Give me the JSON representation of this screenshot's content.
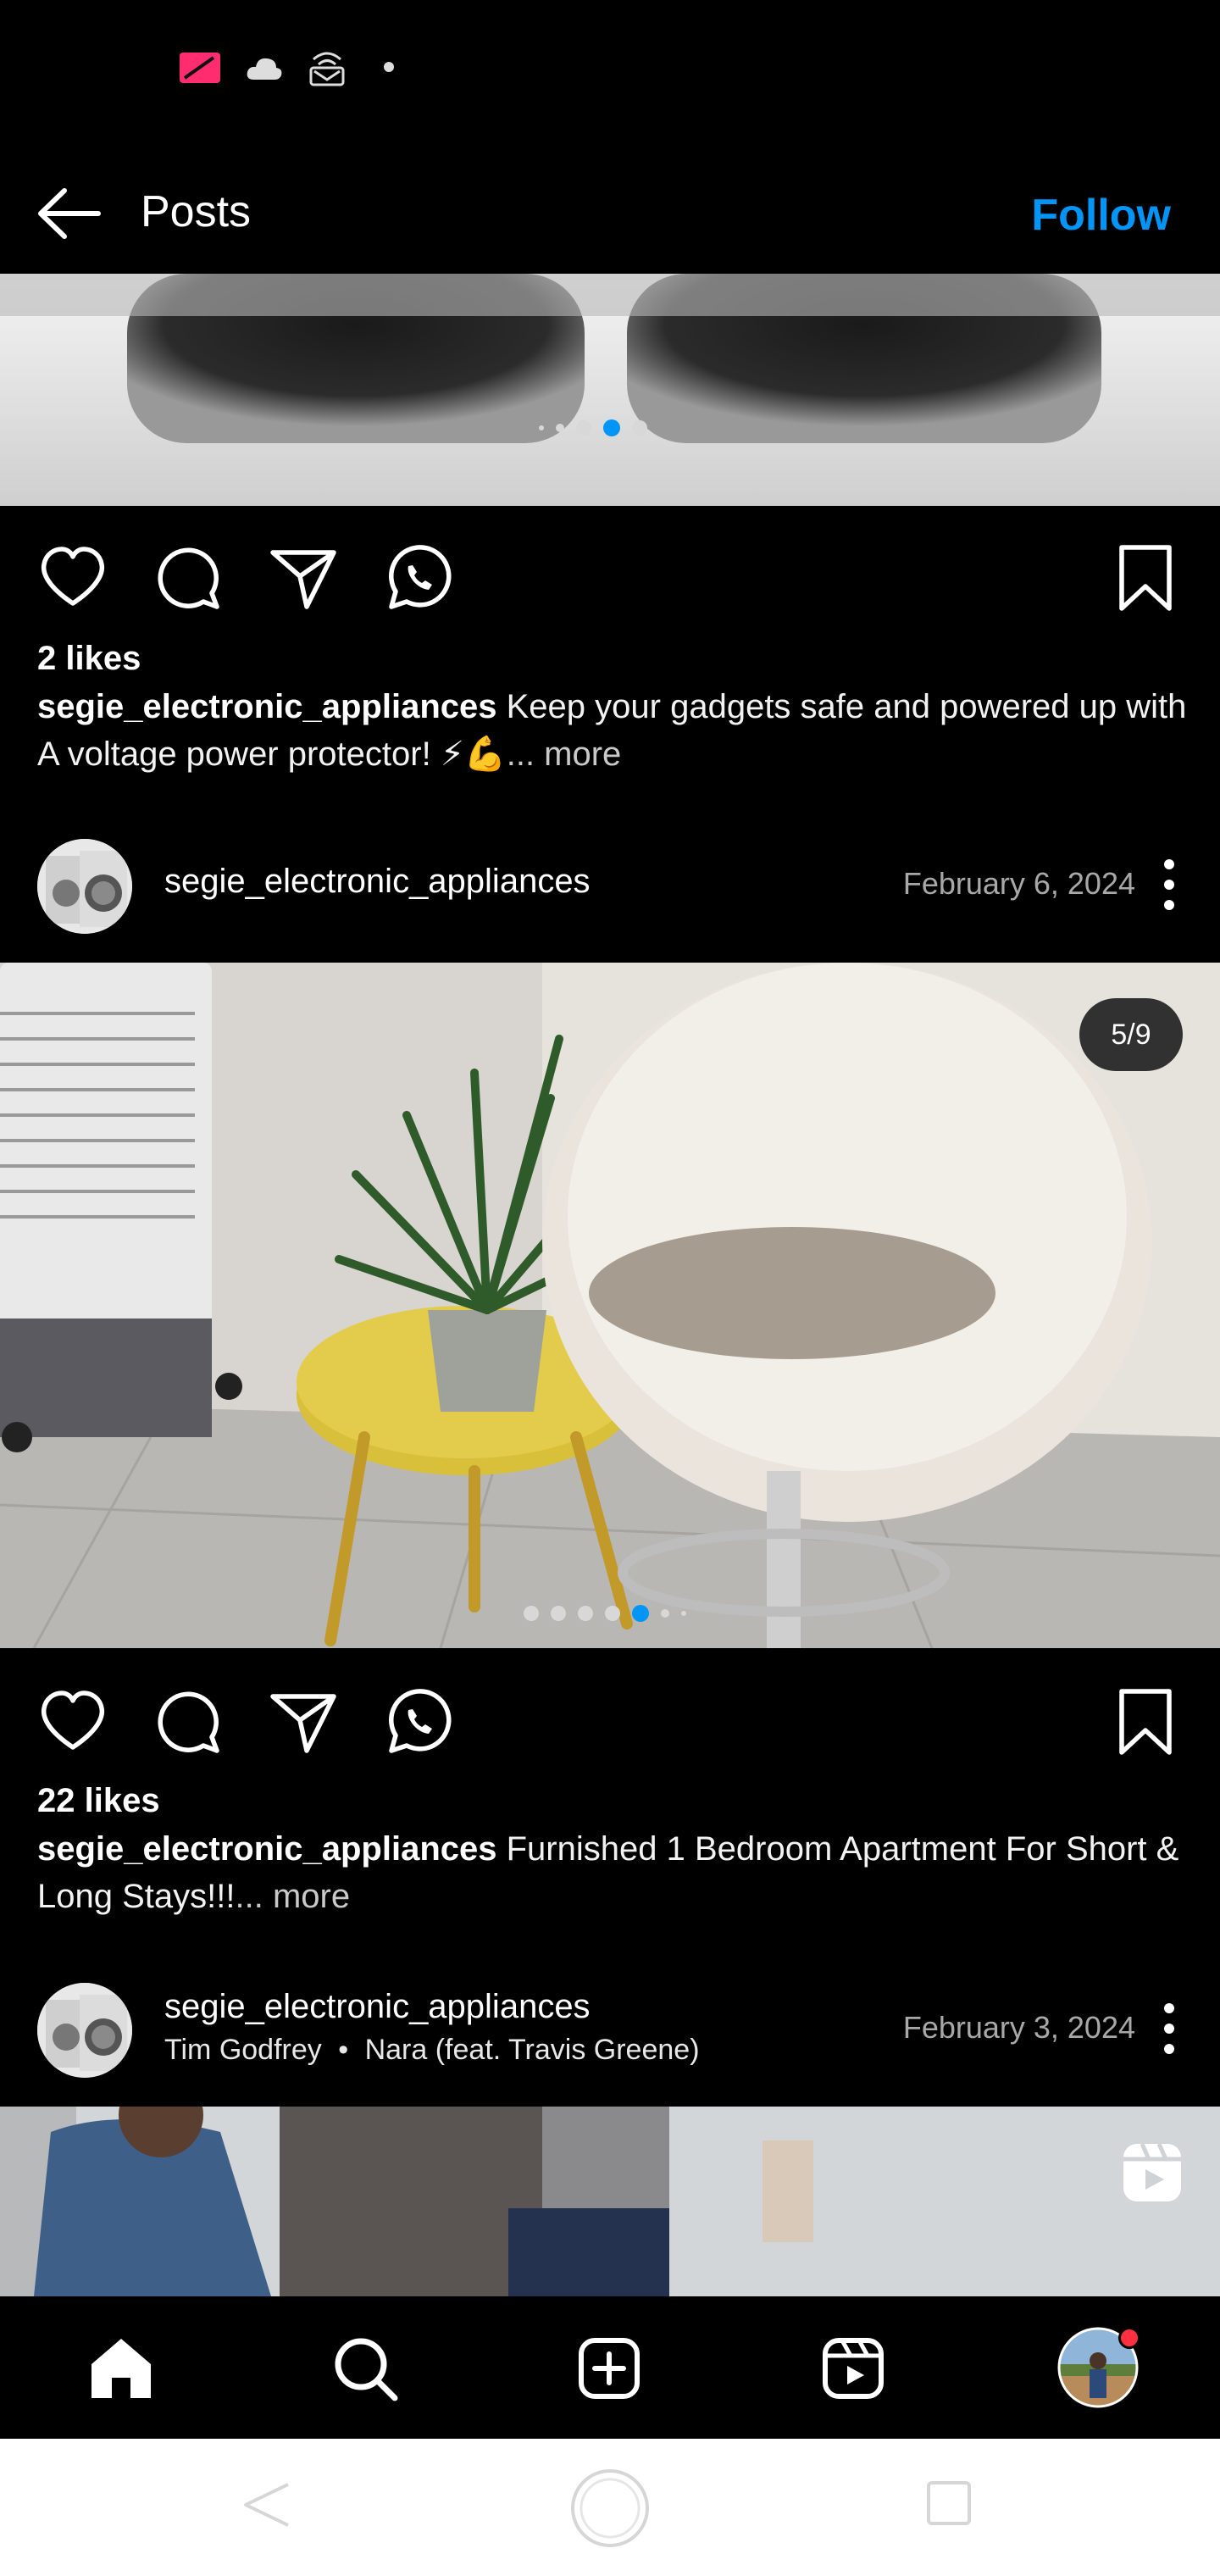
{
  "header": {
    "title": "Posts",
    "follow_label": "Follow"
  },
  "posts": [
    {
      "likes": "2 likes",
      "username": "segie_electronic_appliances",
      "caption": "Keep your gadgets safe and powered up with A voltage power protector! ⚡💪",
      "more": "... more"
    },
    {
      "username": "segie_electronic_appliances",
      "date": "February 6, 2024",
      "counter": "5/9",
      "likes": "22 likes",
      "caption": "Furnished 1 Bedroom Apartment For Short & Long Stays!!!",
      "more": "... more"
    },
    {
      "username": "segie_electronic_appliances",
      "artist": "Tim Godfrey",
      "separator": "•",
      "song": "Nara (feat. Travis Greene)",
      "date": "February 3, 2024"
    }
  ],
  "colors": {
    "accent": "#0095f6",
    "background": "#000000",
    "notification": "#ff3040"
  },
  "icons": {
    "actions": [
      "heart-icon",
      "comment-icon",
      "share-icon",
      "whatsapp-icon",
      "bookmark-icon"
    ],
    "nav": [
      "home-icon",
      "search-icon",
      "create-icon",
      "reels-icon",
      "profile-avatar"
    ]
  }
}
